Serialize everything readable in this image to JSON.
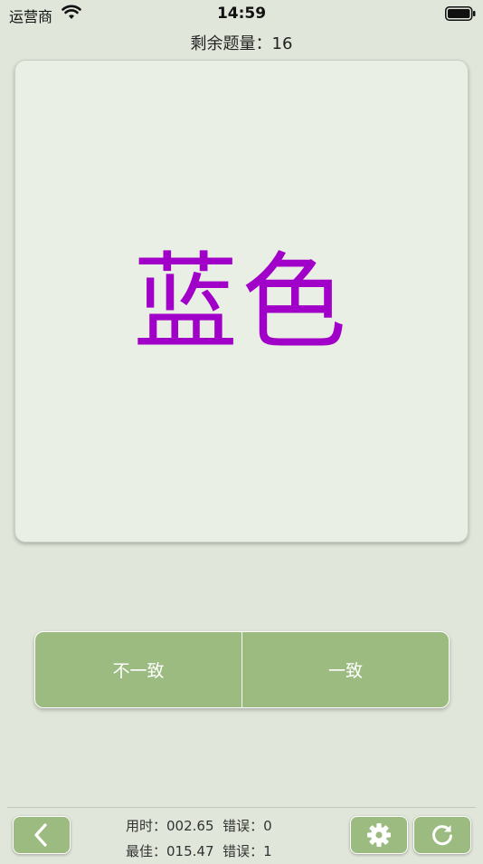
{
  "status_bar": {
    "carrier": "运营商",
    "time": "14:59"
  },
  "header": {
    "remaining_label": "剩余题量：",
    "remaining_value": "16"
  },
  "card": {
    "word": "蓝色",
    "word_color": "#a100c8"
  },
  "answers": {
    "inconsistent_label": "不一致",
    "consistent_label": "一致"
  },
  "stats": {
    "time_label": "用时：",
    "time_value": "002.65",
    "errors_label": "错误：",
    "errors_value": "0",
    "best_label": "最佳：",
    "best_value": "015.47",
    "best_errors_label": "错误：",
    "best_errors_value": "1"
  },
  "colors": {
    "background": "#e1e6da",
    "card": "#eaefe5",
    "button": "#9cbb80"
  },
  "icons": {
    "back": "chevron-left-icon",
    "settings": "gear-icon",
    "refresh": "refresh-icon"
  }
}
